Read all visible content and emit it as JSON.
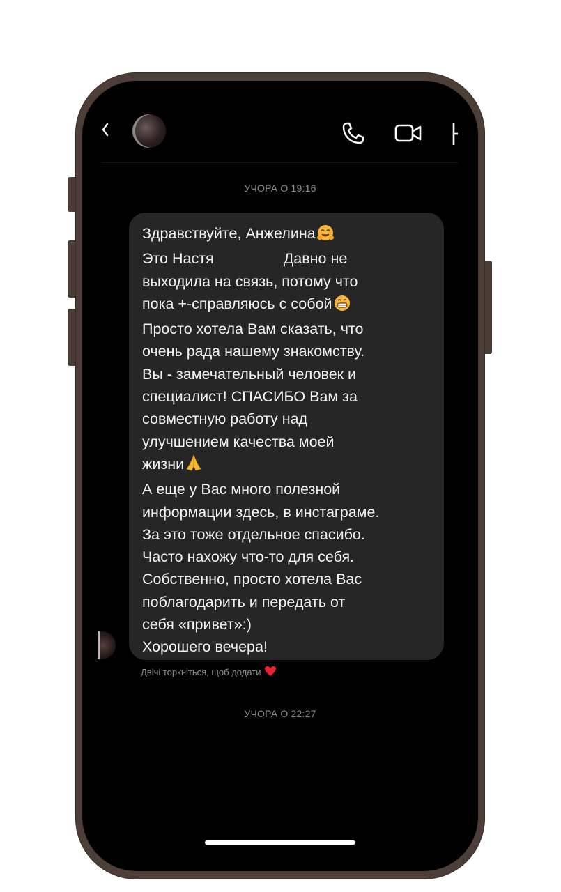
{
  "header": {
    "back_icon": "chevron-left-icon",
    "call_icon": "phone-icon",
    "video_icon": "video-camera-icon",
    "info_icon": "info-icon"
  },
  "timestamps": {
    "first": "УЧОРА О 19:16",
    "second": "УЧОРА О 22:27"
  },
  "message": {
    "lines": [
      "Здравствуйте, Анжелина",
      "Это Настя",
      "Давно не",
      "выходила на связь, потому что",
      "пока +-справляюсь с собой",
      "Просто хотела Вам сказать, что",
      "очень рада нашему знакомству.",
      "Вы - замечательный человек и",
      "специалист! СПАСИБО Вам за",
      "совместную работу над",
      "улучшением качества моей",
      "жизни",
      "А еще у Вас много полезной",
      "информации здесь, в инстаграме.",
      "За это тоже отдельное спасибо.",
      "Часто нахожу что-то для себя.",
      "Собственно, просто хотела Вас",
      "поблагодарить и передать от",
      "себя «привет»:)",
      "Хорошего вечера!"
    ],
    "emojis": {
      "hug": "hugging-face-emoji",
      "grin": "grinning-face-emoji",
      "pray": "folded-hands-emoji"
    }
  },
  "reaction_hint": {
    "text": "Двічі торкніться, щоб додати",
    "icon": "heart-icon",
    "color": "#e8232f"
  },
  "colors": {
    "screen": "#000000",
    "bubble": "#262626",
    "frame": "#4d3e37"
  }
}
